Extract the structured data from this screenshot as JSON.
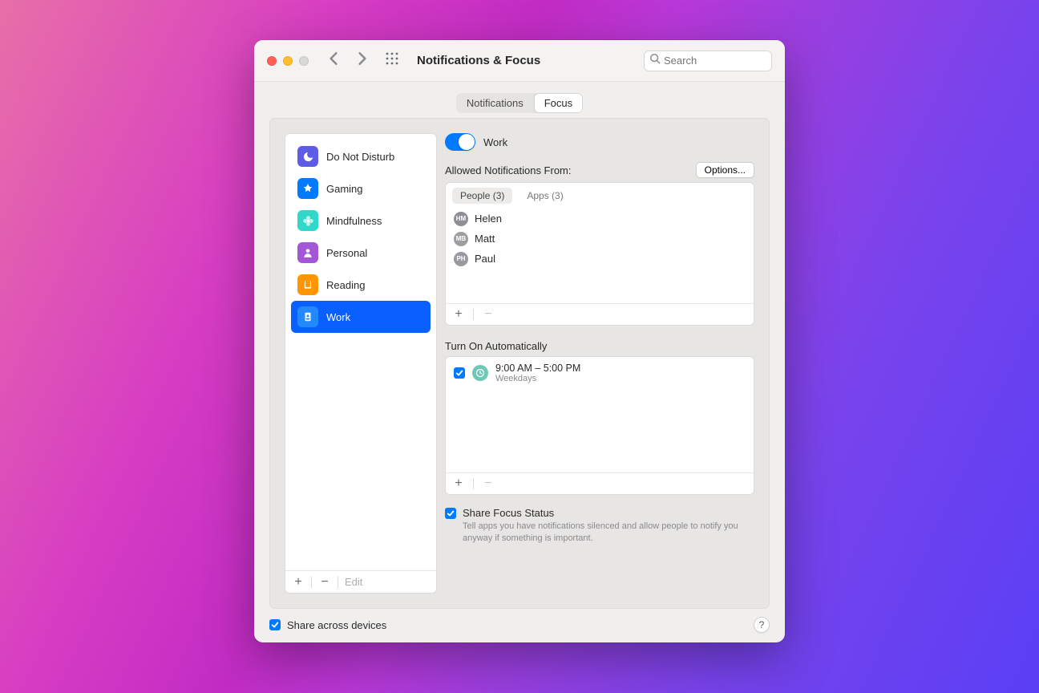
{
  "window": {
    "title": "Notifications & Focus",
    "search_placeholder": "Search"
  },
  "tabs": {
    "notifications": "Notifications",
    "focus": "Focus"
  },
  "sidebar": {
    "items": [
      {
        "label": "Do Not Disturb",
        "icon": "moon",
        "color": "#5e5ce6"
      },
      {
        "label": "Gaming",
        "icon": "rocket",
        "color": "#007aff"
      },
      {
        "label": "Mindfulness",
        "icon": "flower",
        "color": "#30d8c9"
      },
      {
        "label": "Personal",
        "icon": "person",
        "color": "#a357d7"
      },
      {
        "label": "Reading",
        "icon": "book",
        "color": "#ff9500"
      },
      {
        "label": "Work",
        "icon": "badge",
        "color": "#007aff"
      }
    ],
    "selected": 5,
    "edit": "Edit"
  },
  "detail": {
    "title": "Work",
    "allowed_label": "Allowed Notifications From:",
    "options_btn": "Options...",
    "inner_tabs": {
      "people": "People (3)",
      "apps": "Apps (3)"
    },
    "people": [
      {
        "name": "Helen",
        "initials": "HM"
      },
      {
        "name": "Matt",
        "initials": "MB"
      },
      {
        "name": "Paul",
        "initials": "PH"
      }
    ],
    "auto_label": "Turn On Automatically",
    "schedules": [
      {
        "time": "9:00 AM – 5:00 PM",
        "days": "Weekdays",
        "enabled": true
      }
    ],
    "share_status": {
      "title": "Share Focus Status",
      "desc": "Tell apps you have notifications silenced and allow people to notify you anyway if something is important."
    }
  },
  "bottom": {
    "share_across": "Share across devices"
  }
}
